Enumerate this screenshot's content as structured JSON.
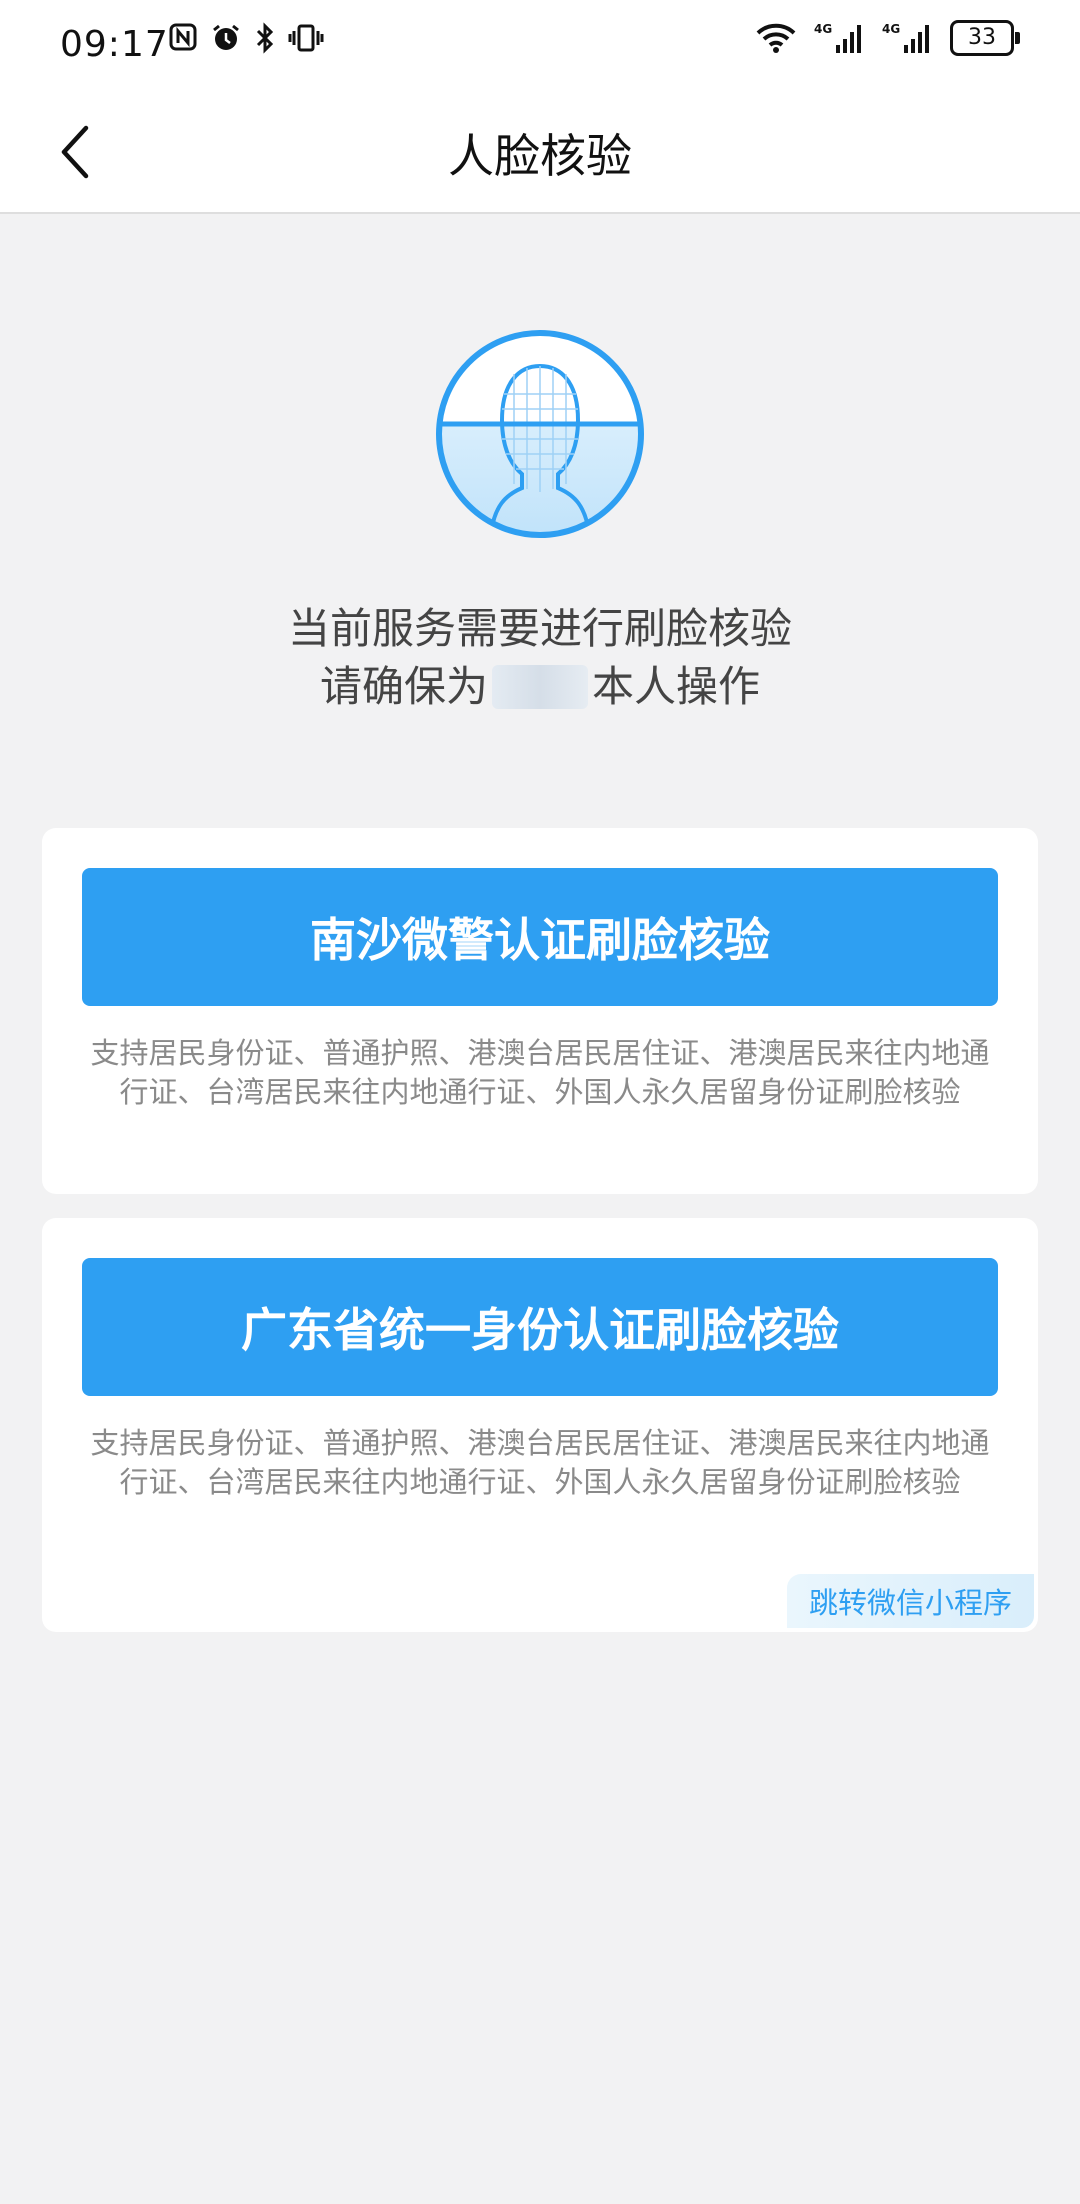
{
  "status_bar": {
    "time": "09:17",
    "battery": "33",
    "network_1": "4G",
    "network_2": "4G"
  },
  "nav": {
    "title": "人脸核验"
  },
  "notice": {
    "line1": "当前服务需要进行刷脸核验",
    "line2_prefix": "请确保为",
    "line2_suffix": "本人操作"
  },
  "options": [
    {
      "button_label": "南沙微警认证刷脸核验",
      "description": "支持居民身份证、普通护照、港澳台居民居住证、港澳居民来往内地通行证、台湾居民来往内地通行证、外国人永久居留身份证刷脸核验"
    },
    {
      "button_label": "广东省统一身份认证刷脸核验",
      "description": "支持居民身份证、普通护照、港澳台居民居住证、港澳居民来往内地通行证、台湾居民来往内地通行证、外国人永久居留身份证刷脸核验",
      "link_label": "跳转微信小程序"
    }
  ],
  "colors": {
    "accent": "#2e9ff2",
    "background": "#f2f2f3"
  }
}
